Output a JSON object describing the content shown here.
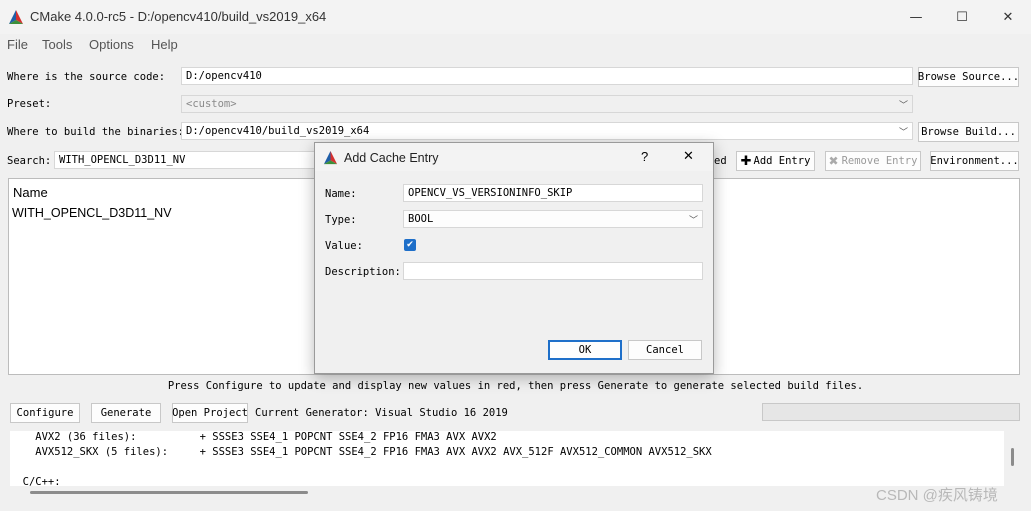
{
  "window": {
    "title": "CMake 4.0.0-rc5 - D:/opencv410/build_vs2019_x64",
    "minimize_glyph": "—",
    "maximize_glyph": "☐",
    "close_glyph": "✕"
  },
  "menu": {
    "items": [
      "File",
      "Tools",
      "Options",
      "Help"
    ]
  },
  "source": {
    "label": "Where is the source code:",
    "value": "D:/opencv410",
    "browse_label": "Browse Source..."
  },
  "preset": {
    "label": "Preset:",
    "value": "<custom>"
  },
  "binaries": {
    "label": "Where to build the binaries:",
    "value": "D:/opencv410/build_vs2019_x64",
    "browse_label": "Browse Build..."
  },
  "search": {
    "label": "Search:",
    "value": "WITH_OPENCL_D3D11_NV",
    "hidden_suffix": "ed"
  },
  "toolbar": {
    "add_entry_label": "Add Entry",
    "remove_entry_label": "Remove Entry",
    "environment_label": "Environment..."
  },
  "tree": {
    "column_header": "Name",
    "rows": [
      "WITH_OPENCL_D3D11_NV"
    ]
  },
  "hint_text": "Press Configure to update and display new values in red, then press Generate to generate selected build files.",
  "actions": {
    "configure_label": "Configure",
    "generate_label": "Generate",
    "open_project_label": "Open Project",
    "generator_text": "Current Generator: Visual Studio 16 2019"
  },
  "output_lines": [
    "    AVX2 (36 files):          + SSSE3 SSE4_1 POPCNT SSE4_2 FP16 FMA3 AVX AVX2",
    "    AVX512_SKX (5 files):     + SSSE3 SSE4_1 POPCNT SSE4_2 FP16 FMA3 AVX AVX2 AVX_512F AVX512_COMMON AVX512_SKX",
    "",
    "  C/C++:"
  ],
  "watermark": "CSDN @疾风铸境",
  "dialog": {
    "title": "Add Cache Entry",
    "help_glyph": "?",
    "close_glyph": "✕",
    "name_label": "Name:",
    "name_value": "OPENCV_VS_VERSIONINFO_SKIP",
    "type_label": "Type:",
    "type_value": "BOOL",
    "value_label": "Value:",
    "value_checked": true,
    "description_label": "Description:",
    "description_value": "",
    "ok_label": "OK",
    "cancel_label": "Cancel"
  },
  "colors": {
    "accent": "#1e6fc9",
    "logo_red": "#d5302f",
    "logo_blue": "#1f5ea8",
    "logo_green": "#3d8f3b"
  }
}
